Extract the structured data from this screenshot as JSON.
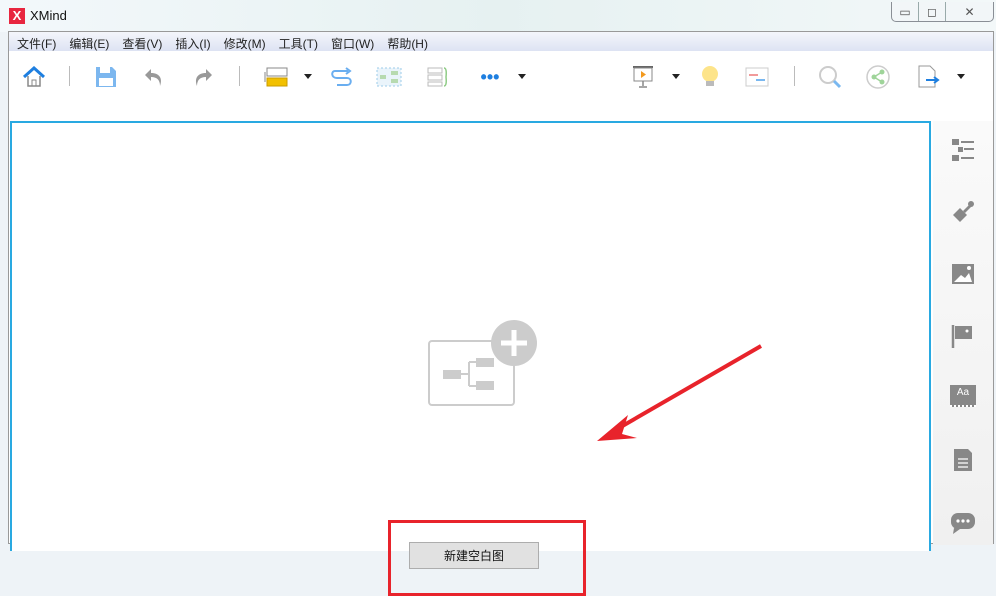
{
  "window": {
    "title": "XMind",
    "logo": "X",
    "controls": {
      "minimize": "▭",
      "restore": "◻",
      "close": "✕"
    }
  },
  "menu": [
    "文件(F)",
    "编辑(E)",
    "查看(V)",
    "插入(I)",
    "修改(M)",
    "工具(T)",
    "窗口(W)",
    "帮助(H)"
  ],
  "toolbar": [
    "home-icon",
    "save-icon",
    "undo-icon",
    "redo-icon",
    "topic-icon",
    "relationship-icon",
    "boundary-icon",
    "summary-icon",
    "more-icon",
    "presentation-icon",
    "idea-icon",
    "gantt-icon",
    "search-icon",
    "share-icon",
    "export-icon"
  ],
  "sidebar": [
    "outline-icon",
    "format-icon",
    "image-icon",
    "marker-icon",
    "text-style-icon",
    "notes-icon",
    "comments-icon"
  ],
  "sidebar_text_label": "Aa",
  "canvas": {
    "new_blank_button": "新建空白图"
  },
  "colors": {
    "accent": "#29a9e1",
    "highlight": "#e8232b",
    "logo": "#e8263f"
  }
}
